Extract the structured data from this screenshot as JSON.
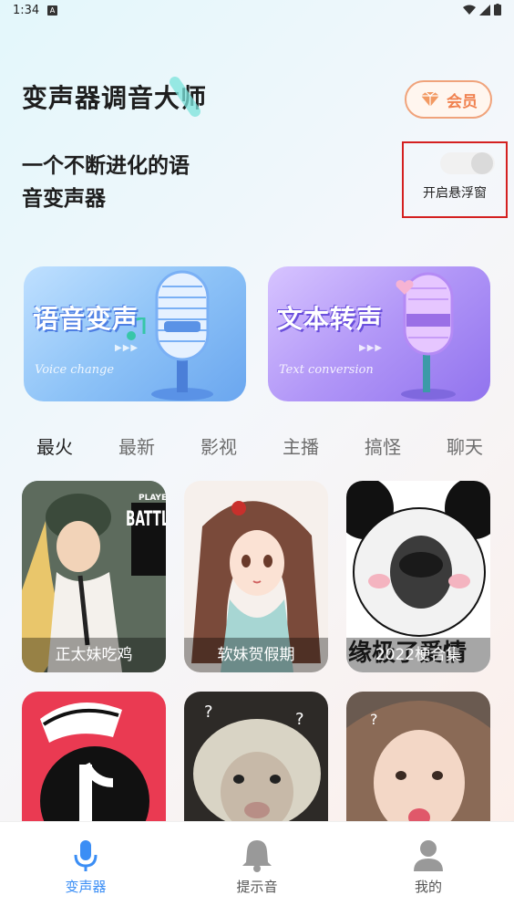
{
  "status_bar": {
    "time": "1:34",
    "notif": "A"
  },
  "header": {
    "title": "变声器调音大师",
    "vip_label": "会员"
  },
  "subtitle": {
    "line1": "一个不断进化的语",
    "line2": "音变声器"
  },
  "float_window": {
    "label": "开启悬浮窗",
    "enabled": false
  },
  "feature_cards": [
    {
      "title": "语音变声",
      "subtitle": "Voice change"
    },
    {
      "title": "文本转声",
      "subtitle": "Text conversion"
    }
  ],
  "tabs": [
    "最火",
    "最新",
    "影视",
    "主播",
    "搞怪",
    "聊天"
  ],
  "active_tab": "最火",
  "grid": [
    {
      "label": "正太妹吃鸡",
      "thumb_text": "BATTLE",
      "thumb_text_2": "PLAYE"
    },
    {
      "label": "软妹贺假期"
    },
    {
      "label": "2022梗合集",
      "thumb_text": "缘极了爱情"
    },
    {
      "label": ""
    },
    {
      "label": ""
    },
    {
      "label": ""
    }
  ],
  "bottom_nav": [
    {
      "label": "变声器",
      "icon": "microphone-icon",
      "active": true
    },
    {
      "label": "提示音",
      "icon": "bell-icon",
      "active": false
    },
    {
      "label": "我的",
      "icon": "user-icon",
      "active": false
    }
  ],
  "colors": {
    "accent": "#3b8ef5",
    "vip": "#f08250",
    "highlight_border": "#d42020"
  }
}
